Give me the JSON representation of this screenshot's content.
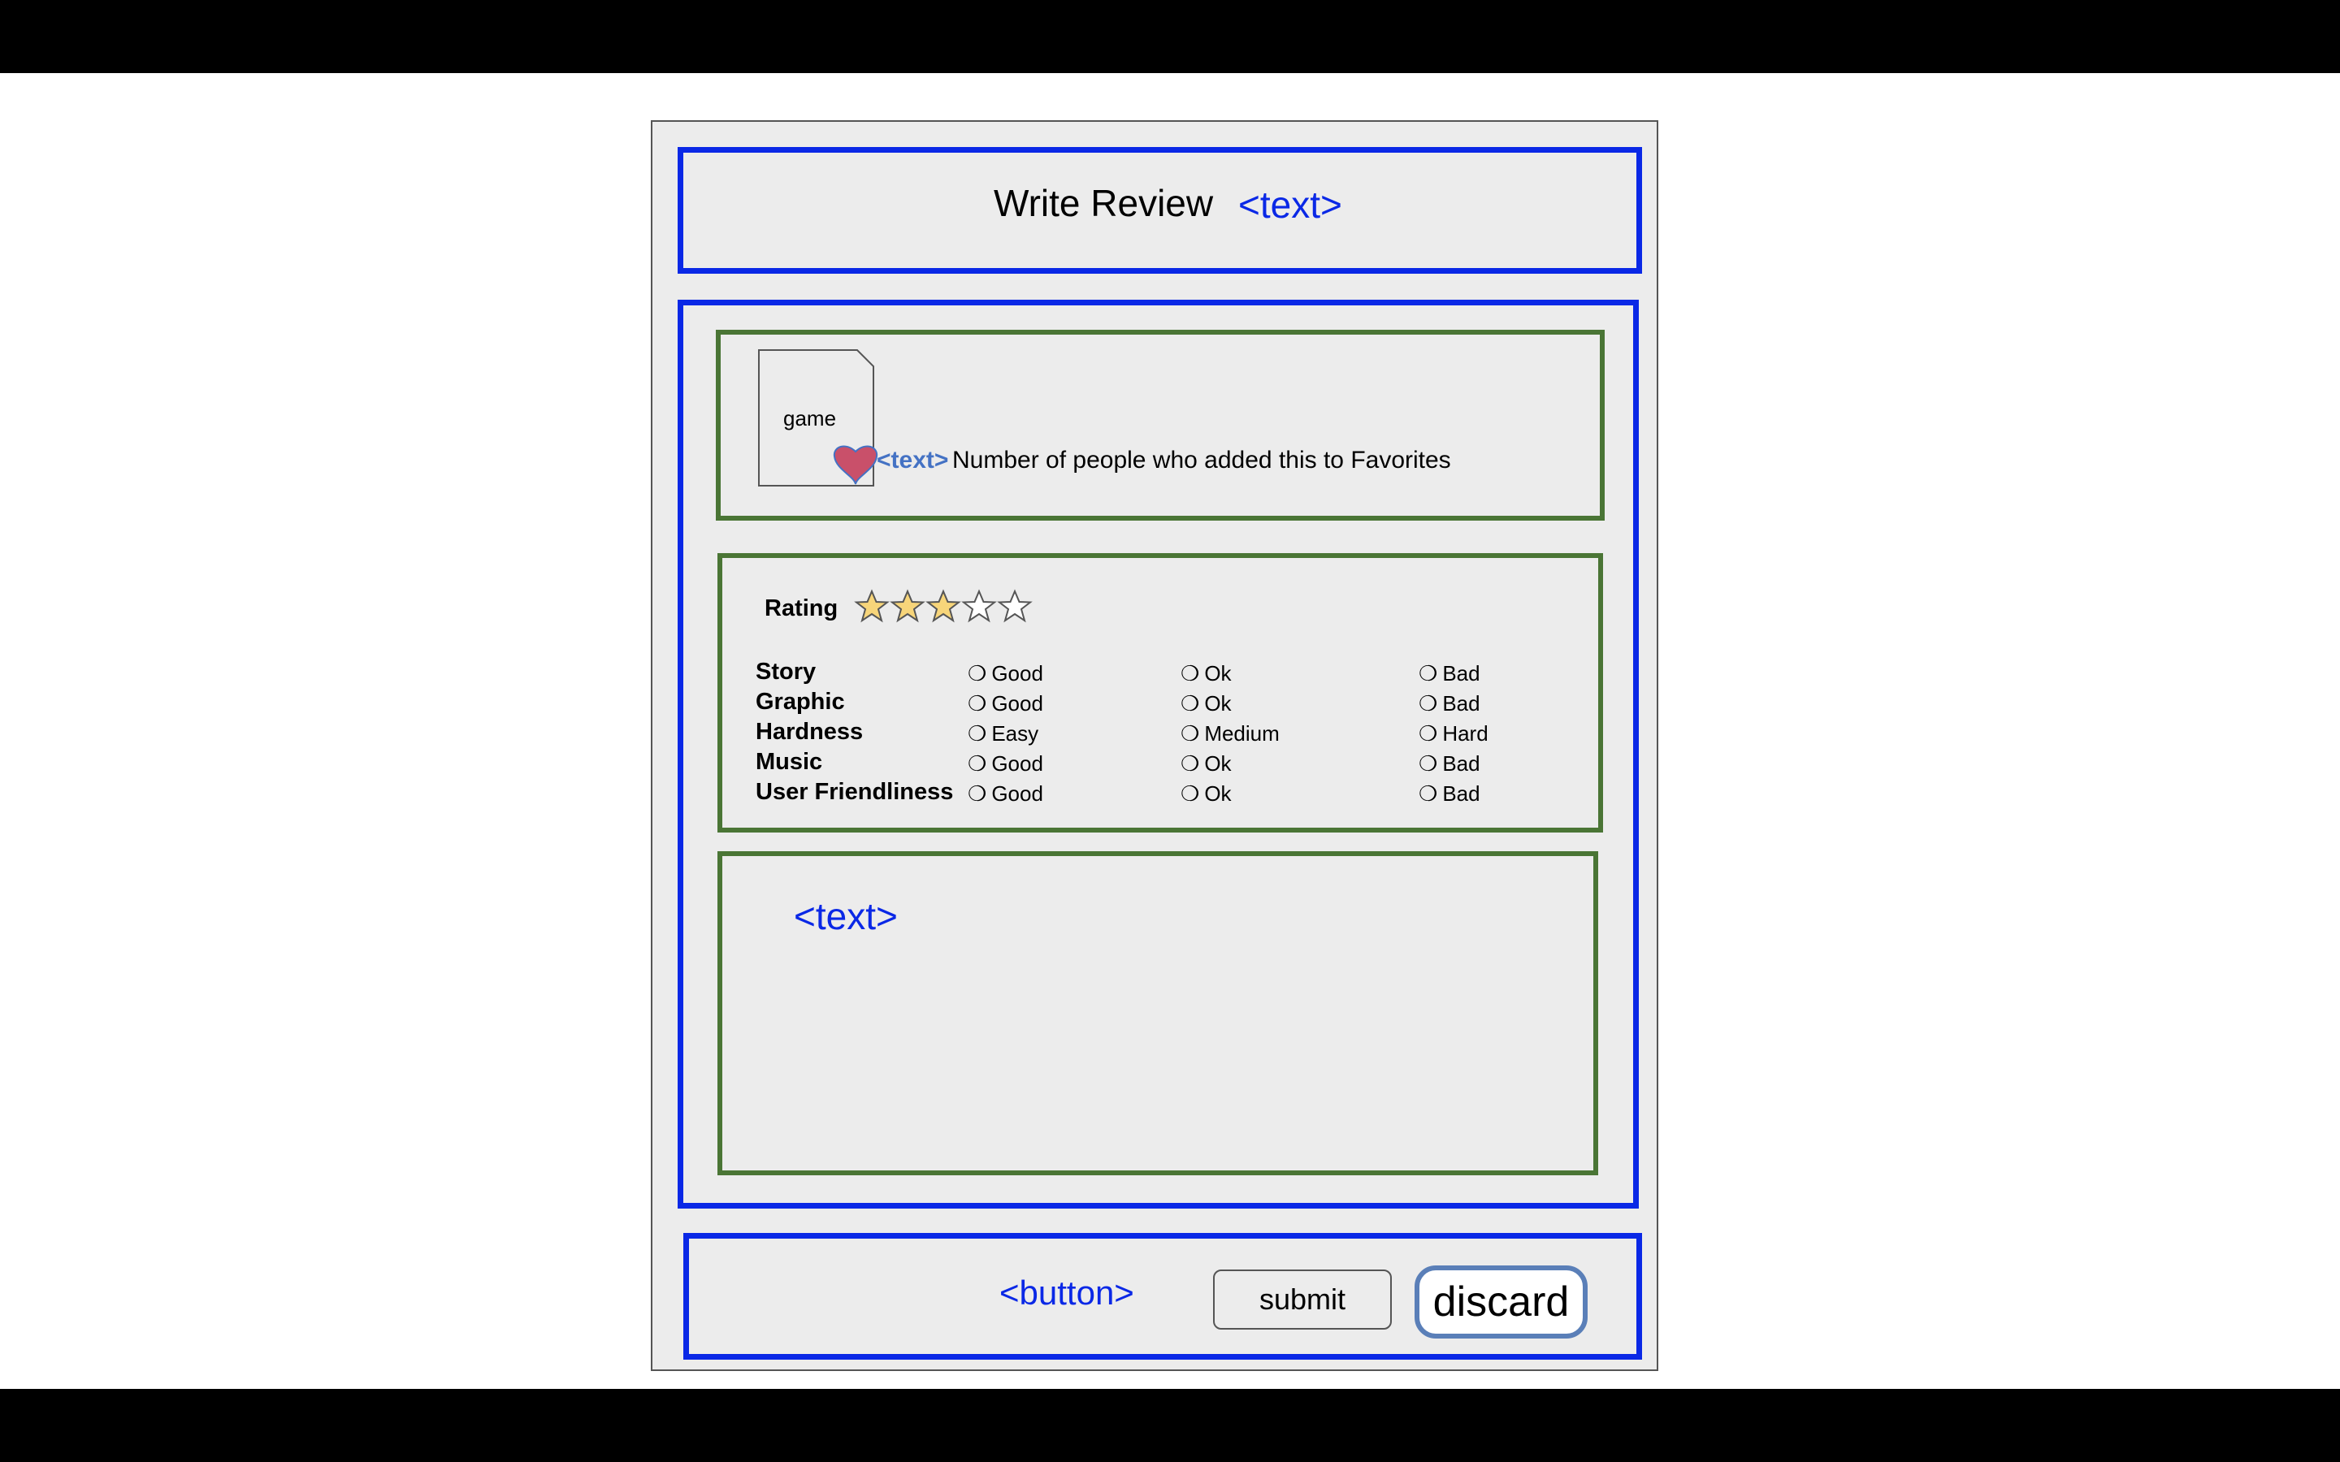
{
  "header": {
    "title": "Write Review",
    "title_placeholder": "<text>"
  },
  "game": {
    "thumbnail_label": "game",
    "favorites_placeholder": "<text>",
    "favorites_text": "Number of people who added this to Favorites"
  },
  "rating": {
    "label": "Rating",
    "stars_filled": 3,
    "stars_total": 5,
    "star_fill_color": "#f7d57a",
    "criteria": [
      {
        "name": "Story",
        "options": [
          "Good",
          "Ok",
          "Bad"
        ]
      },
      {
        "name": "Graphic",
        "options": [
          "Good",
          "Ok",
          "Bad"
        ]
      },
      {
        "name": "Hardness",
        "options": [
          "Easy",
          "Medium",
          "Hard"
        ]
      },
      {
        "name": "Music",
        "options": [
          "Good",
          "Ok",
          "Bad"
        ]
      },
      {
        "name": "User Friendliness",
        "options": [
          "Good",
          "Ok",
          "Bad"
        ]
      }
    ],
    "radio_glyph": "❍"
  },
  "review": {
    "text_placeholder": "<text>"
  },
  "footer": {
    "button_placeholder": "<button>",
    "submit_label": "submit",
    "discard_label": "discard"
  },
  "colors": {
    "container_border": "#0a28e6",
    "section_border": "#4a7535",
    "heart": "#c9506a"
  }
}
